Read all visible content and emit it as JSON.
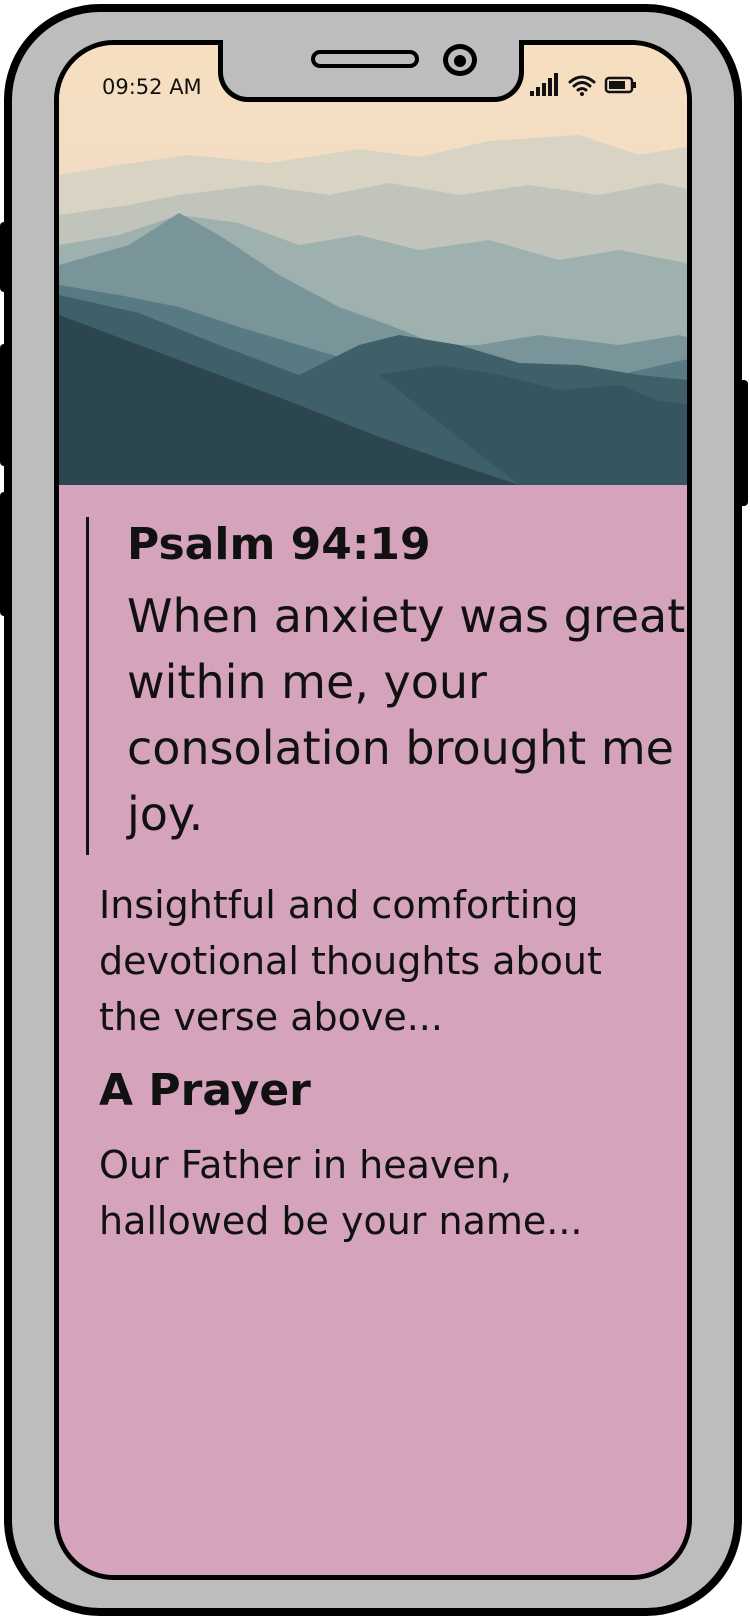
{
  "status_bar": {
    "time": "09:52 AM",
    "icons": [
      "signal-icon",
      "wifi-icon",
      "battery-icon"
    ]
  },
  "hero": {
    "image": "misty-mountains"
  },
  "verse": {
    "reference": "Psalm 94:19",
    "text": "When anxiety was great within me, your consolation brought me joy."
  },
  "devotional": {
    "text": "Insightful and comforting devotional thoughts about the verse above..."
  },
  "prayer": {
    "title": "A Prayer",
    "text": "Our Father in heaven, hallowed be your name..."
  },
  "colors": {
    "content_background": "#d6a3bd",
    "device_frame": "#bdbdbd",
    "text": "#111111"
  }
}
